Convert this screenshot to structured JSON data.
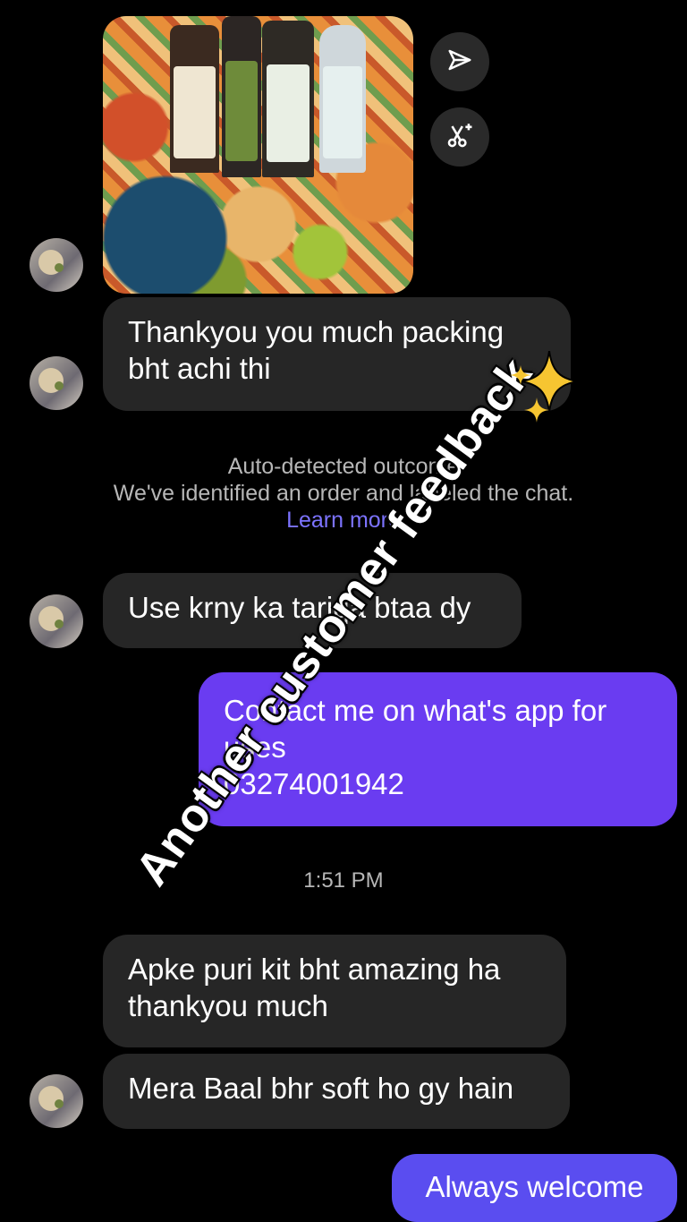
{
  "messages": {
    "m1": "Thankyou you much packing bht achi thi",
    "m2": "Use krny ka tariqa btaa dy",
    "m3_line1": "Contact me on what's app for uses",
    "m3_phone": "03274001942",
    "m4": "Apke puri kit bht amazing ha thankyou much",
    "m5": "Mera Baal bhr soft ho gy hain",
    "m6": "Always welcome"
  },
  "notice": {
    "line1": "Auto-detected outcome",
    "line2": "We've identified an order and labeled the chat.",
    "link": "Learn more"
  },
  "timestamp": "1:51 PM",
  "overlay": {
    "caption": "Another customer feedback"
  },
  "icons": {
    "share": "send-icon",
    "cut": "scissors-sparkle-icon",
    "sparkle": "sparkles-icon"
  },
  "colors": {
    "incoming_bubble": "#262626",
    "outgoing_bubble": "#6a3cf1",
    "link": "#7c73ff"
  }
}
